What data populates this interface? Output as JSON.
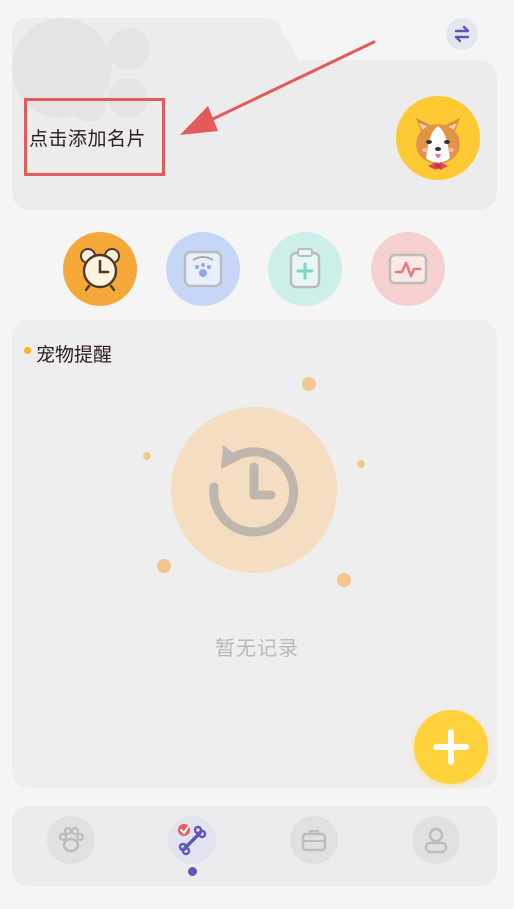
{
  "profile": {
    "add_card_label": "点击添加名片",
    "avatar_icon": "corgi-avatar-icon"
  },
  "header": {
    "swap_icon": "swap-arrows-icon"
  },
  "quick_actions": [
    {
      "icon": "alarm-clock-icon",
      "color": "#f5a83a"
    },
    {
      "icon": "pet-scale-icon",
      "color": "#c6d6f7"
    },
    {
      "icon": "medical-clipboard-icon",
      "color": "#cdeee9"
    },
    {
      "icon": "health-monitor-icon",
      "color": "#f6cfcf"
    }
  ],
  "reminders": {
    "title": "宠物提醒",
    "empty_text": "暂无记录",
    "empty_icon": "history-clock-icon",
    "add_icon": "plus-icon"
  },
  "bottom_nav": {
    "items": [
      {
        "icon": "paw-icon",
        "active": false
      },
      {
        "icon": "bone-icon",
        "active": true
      },
      {
        "icon": "briefcase-icon",
        "active": false
      },
      {
        "icon": "profile-icon",
        "active": false
      }
    ]
  },
  "colors": {
    "accent_yellow": "#ffd23c",
    "highlight_red": "#e45a5a",
    "nav_active_dot": "#5b58b8",
    "background": "#f5f5f5"
  }
}
